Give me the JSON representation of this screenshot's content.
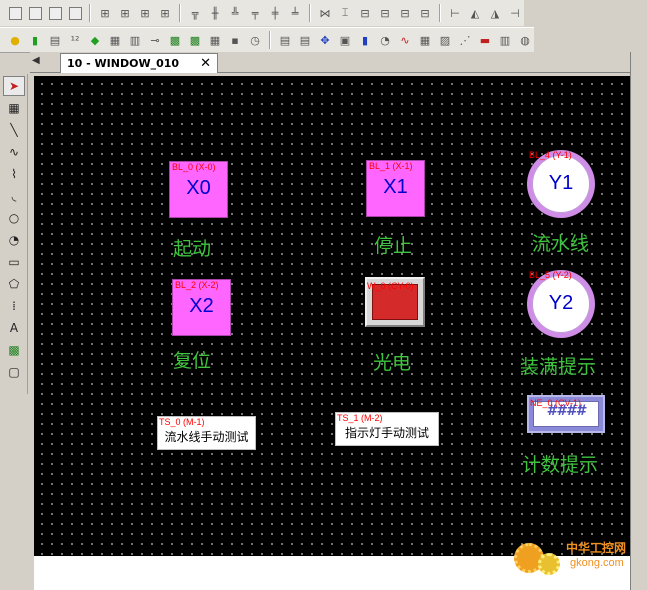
{
  "tab": {
    "title": "10 - WINDOW_010",
    "close": "✕",
    "arrow": "◀"
  },
  "canvas": {
    "bit_buttons": [
      {
        "tag": "BL_0 (X-0)",
        "label": "X0",
        "caption": "起动"
      },
      {
        "tag": "BL_1 (X-1)",
        "label": "X1",
        "caption": "停止"
      },
      {
        "tag": "BL_2 (X-2)",
        "label": "X2",
        "caption": "复位"
      }
    ],
    "lamps": [
      {
        "tag": "BL_4 (Y-1)",
        "label": "Y1",
        "caption": "流水线"
      },
      {
        "tag": "BL_5 (Y-2)",
        "label": "Y2",
        "caption": "装满提示"
      }
    ],
    "red_button": {
      "tag": "W_0 (CY-0)",
      "caption": "光电"
    },
    "text_buttons": [
      {
        "tag": "TS_0 (M-1)",
        "label": "流水线手动测试"
      },
      {
        "tag": "TS_1 (M-2)",
        "label": "指示灯手动测试"
      }
    ],
    "number_display": {
      "tag": "NE_0 (CV-1)",
      "value": "####",
      "caption": "计数提示"
    }
  },
  "watermark": {
    "cn": "中华工控网",
    "en": "gkong.com"
  },
  "colors": {
    "canvas_bg": "#000000",
    "button_pink": "#ff66ff",
    "label_green": "#3ec43e",
    "tag_red": "#ff0000",
    "text_blue": "#0000cc"
  }
}
